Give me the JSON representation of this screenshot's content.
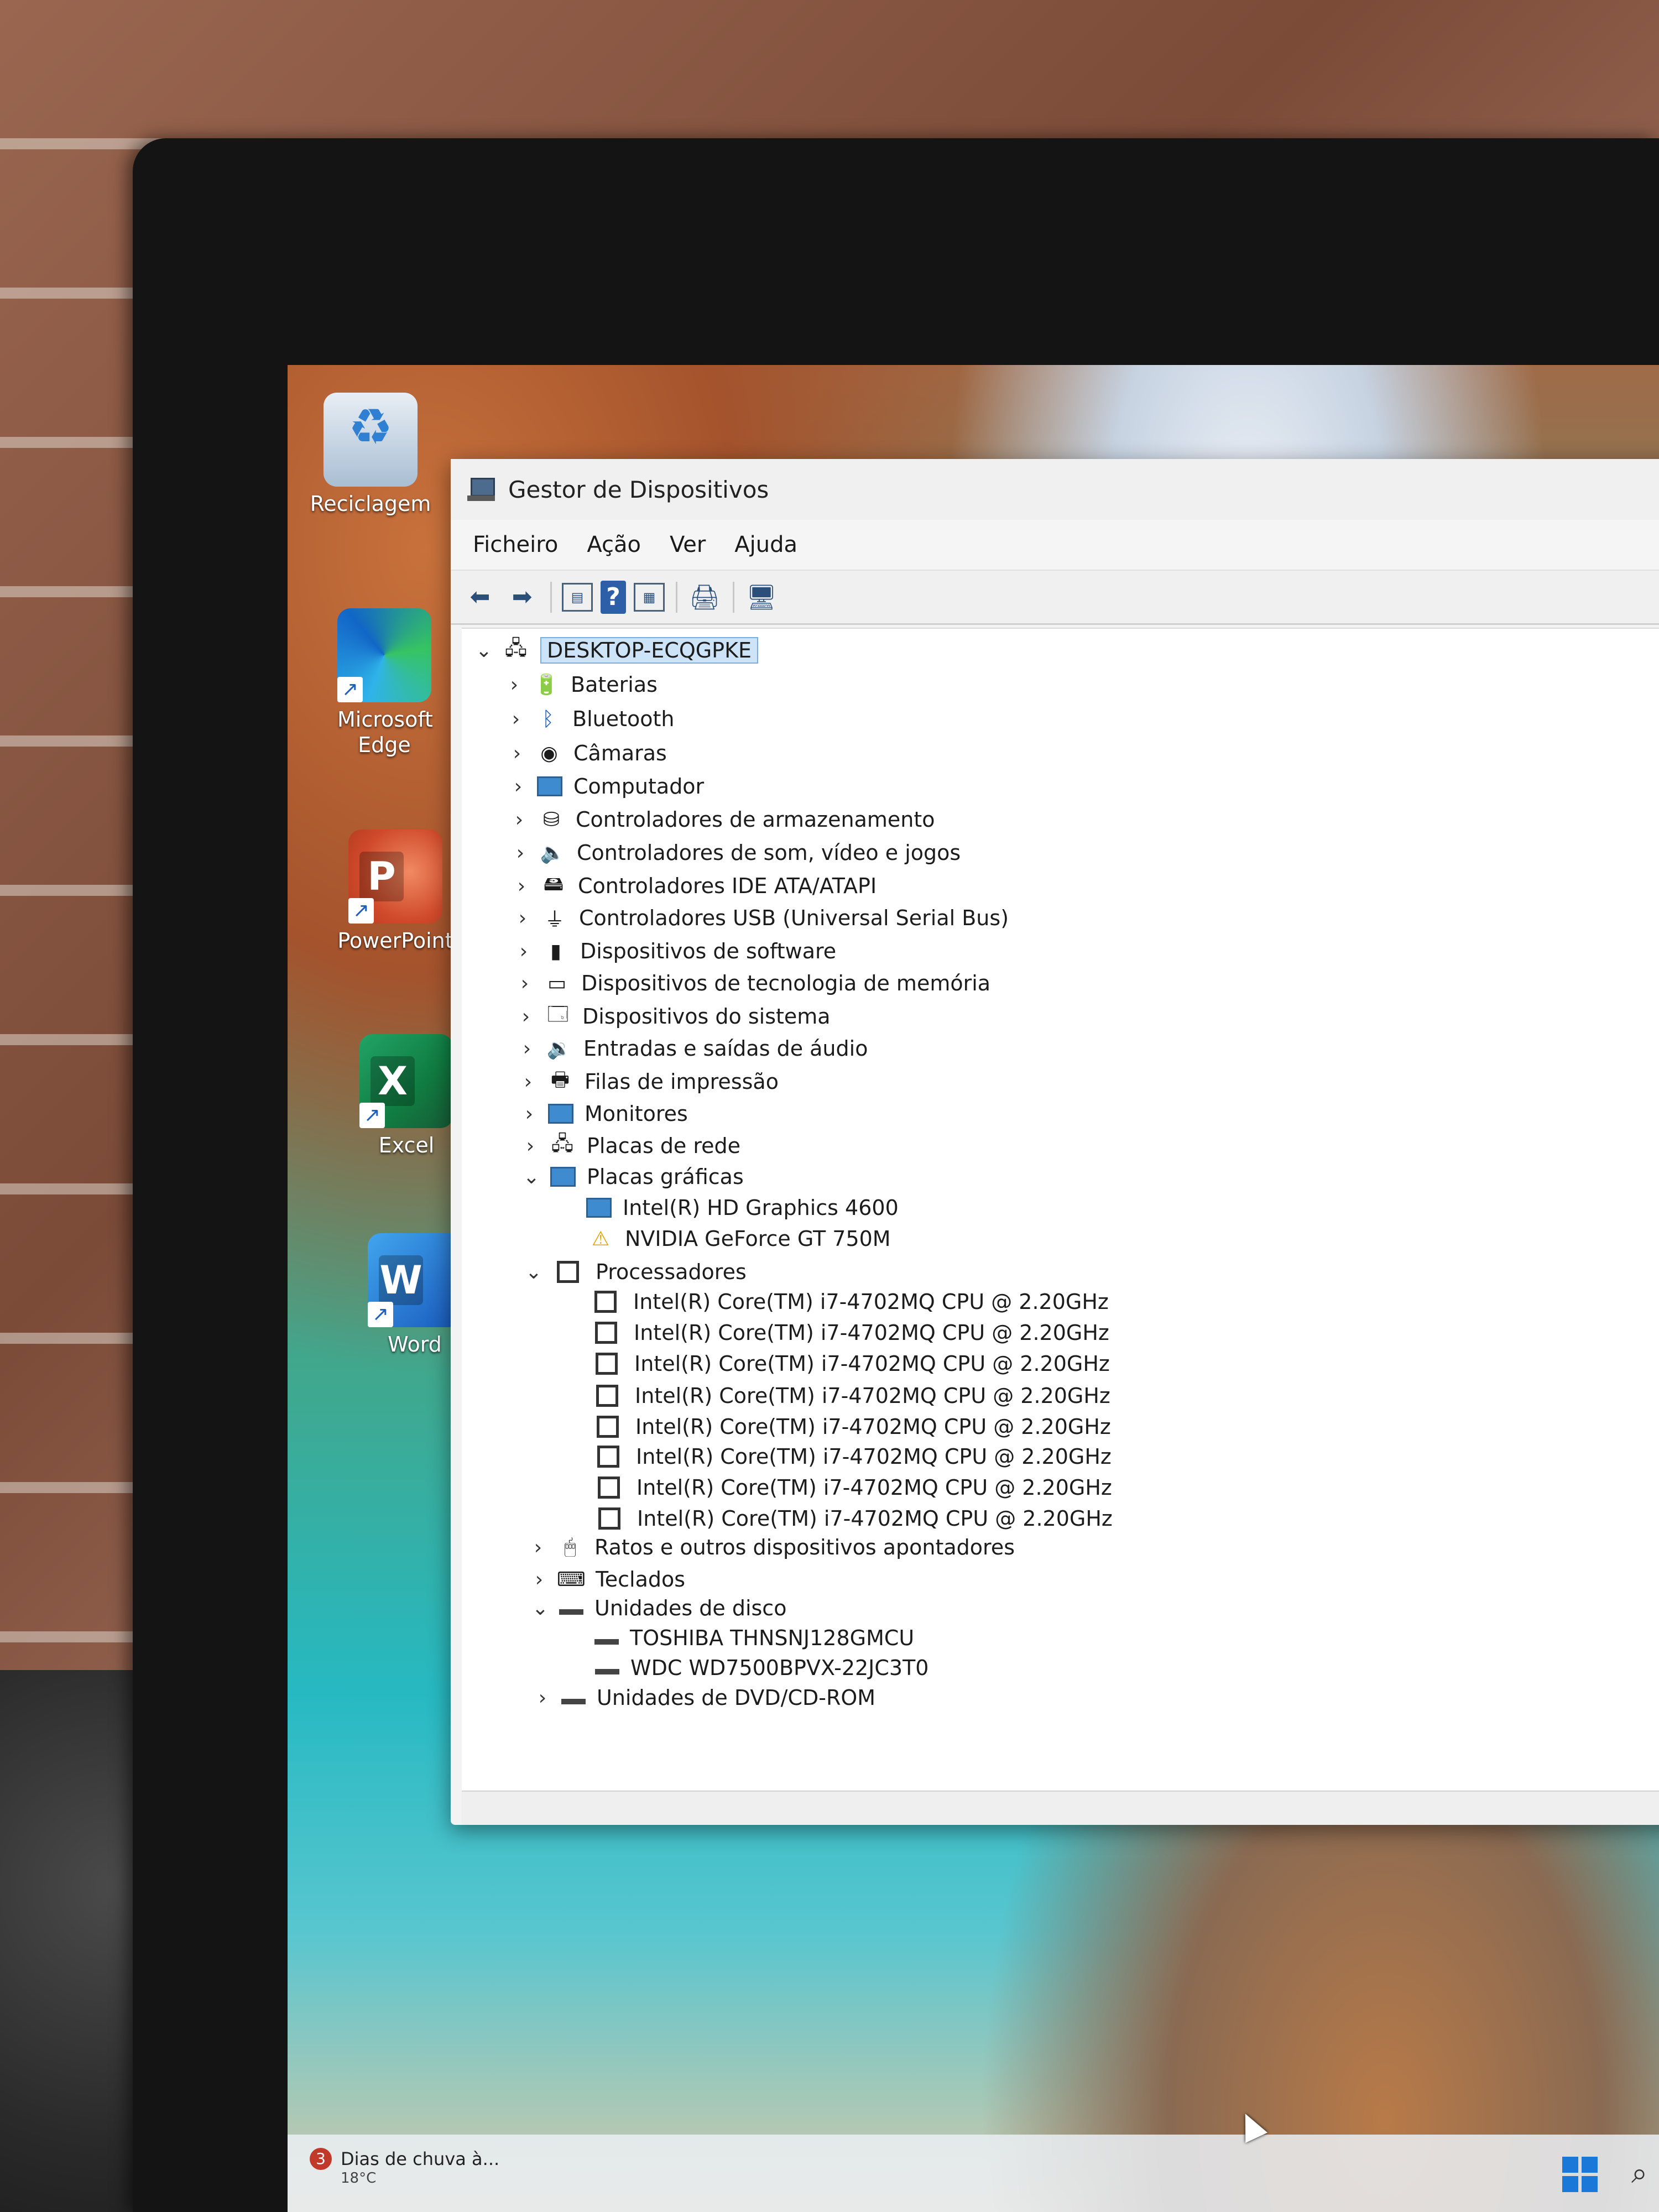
{
  "desktop": {
    "icons": [
      {
        "label": "Reciclagem",
        "icon": "recycle-bin-icon"
      },
      {
        "label": "Microsoft Edge",
        "icon": "edge-icon"
      },
      {
        "label": "PowerPoint",
        "icon": "powerpoint-icon",
        "letter": "P"
      },
      {
        "label": "Excel",
        "icon": "excel-icon",
        "letter": "X"
      },
      {
        "label": "Word",
        "icon": "word-icon",
        "letter": "W"
      }
    ]
  },
  "window": {
    "title": "Gestor de Dispositivos",
    "menu": [
      "Ficheiro",
      "Ação",
      "Ver",
      "Ajuda"
    ],
    "toolbar": {
      "back": "arrow-left-icon",
      "forward": "arrow-right-icon",
      "help_glyph": "?"
    }
  },
  "tree": {
    "root": "DESKTOP-ECQGPKE",
    "categories": [
      "Baterias",
      "Bluetooth",
      "Câmaras",
      "Computador",
      "Controladores de armazenamento",
      "Controladores de som, vídeo e jogos",
      "Controladores IDE ATA/ATAPI",
      "Controladores USB (Universal Serial Bus)",
      "Dispositivos de software",
      "Dispositivos de tecnologia de memória",
      "Dispositivos do sistema",
      "Entradas e saídas de áudio",
      "Filas de impressão",
      "Monitores",
      "Placas de rede",
      "Placas gráficas",
      "Processadores",
      "Ratos e outros dispositivos apontadores",
      "Teclados",
      "Unidades de disco",
      "Unidades de DVD/CD-ROM"
    ],
    "graphics": [
      "Intel(R) HD Graphics 4600",
      "NVIDIA GeForce GT 750M"
    ],
    "processors": [
      "Intel(R) Core(TM) i7-4702MQ CPU @ 2.20GHz",
      "Intel(R) Core(TM) i7-4702MQ CPU @ 2.20GHz",
      "Intel(R) Core(TM) i7-4702MQ CPU @ 2.20GHz",
      "Intel(R) Core(TM) i7-4702MQ CPU @ 2.20GHz",
      "Intel(R) Core(TM) i7-4702MQ CPU @ 2.20GHz",
      "Intel(R) Core(TM) i7-4702MQ CPU @ 2.20GHz",
      "Intel(R) Core(TM) i7-4702MQ CPU @ 2.20GHz",
      "Intel(R) Core(TM) i7-4702MQ CPU @ 2.20GHz"
    ],
    "disks": [
      "TOSHIBA THNSNJ128GMCU",
      "WDC WD7500BPVX-22JC3T0"
    ]
  },
  "taskbar": {
    "weather_badge": "3",
    "weather_text": "Dias de chuva à...",
    "weather_temp": "18°C"
  }
}
